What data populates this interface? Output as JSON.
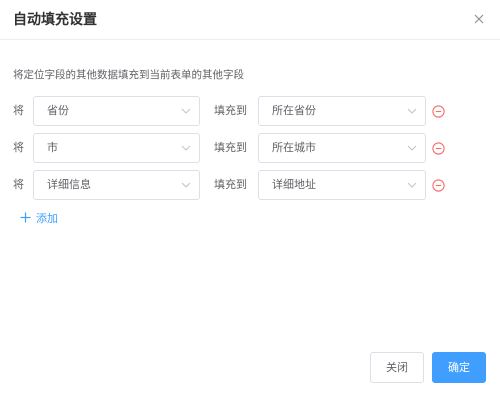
{
  "dialog": {
    "title": "自动填充设置",
    "close_icon": "close-icon",
    "description": "将定位字段的其他数据填充到当前表单的其他字段"
  },
  "rows": [
    {
      "prefix": "将",
      "source": "省份",
      "fill_label": "填充到",
      "target": "所在省份"
    },
    {
      "prefix": "将",
      "source": "市",
      "fill_label": "填充到",
      "target": "所在城市"
    },
    {
      "prefix": "将",
      "source": "详细信息",
      "fill_label": "填充到",
      "target": "详细地址"
    }
  ],
  "add_label": "添加",
  "footer": {
    "cancel_label": "关闭",
    "confirm_label": "确定"
  },
  "colors": {
    "primary": "#409eff",
    "danger": "#f56c6c",
    "border": "#dcdfe6"
  }
}
